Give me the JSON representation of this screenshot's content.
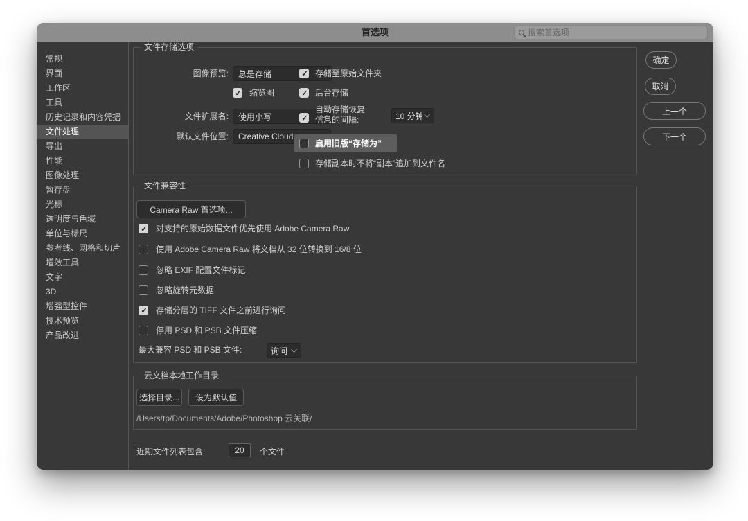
{
  "window": {
    "title": "首选项",
    "search": {
      "placeholder": "搜索首选项"
    }
  },
  "sidebar": {
    "items": [
      {
        "label": "常规",
        "selected": false
      },
      {
        "label": "界面",
        "selected": false
      },
      {
        "label": "工作区",
        "selected": false
      },
      {
        "label": "工具",
        "selected": false
      },
      {
        "label": "历史记录和内容凭据",
        "selected": false
      },
      {
        "label": "文件处理",
        "selected": true
      },
      {
        "label": "导出",
        "selected": false
      },
      {
        "label": "性能",
        "selected": false
      },
      {
        "label": "图像处理",
        "selected": false
      },
      {
        "label": "暂存盘",
        "selected": false
      },
      {
        "label": "光标",
        "selected": false
      },
      {
        "label": "透明度与色域",
        "selected": false
      },
      {
        "label": "单位与标尺",
        "selected": false
      },
      {
        "label": "参考线、网格和切片",
        "selected": false
      },
      {
        "label": "增效工具",
        "selected": false
      },
      {
        "label": "文字",
        "selected": false
      },
      {
        "label": "3D",
        "selected": false
      },
      {
        "label": "增强型控件",
        "selected": false
      },
      {
        "label": "技术预览",
        "selected": false
      },
      {
        "label": "产品改进",
        "selected": false
      }
    ]
  },
  "actions": {
    "ok": "确定",
    "cancel": "取消",
    "prev": "上一个",
    "next": "下一个"
  },
  "file_saving": {
    "title": "文件存储选项",
    "image_preview": {
      "label": "图像预览:",
      "value": "总是存储"
    },
    "thumbnail": {
      "label": "缩览图",
      "checked": true
    },
    "save_to_original": {
      "label": "存储至原始文件夹",
      "checked": true
    },
    "background_save": {
      "label": "后台存储",
      "checked": true
    },
    "file_extension": {
      "label": "文件扩展名:",
      "value": "使用小写"
    },
    "autosave": {
      "label_line1": "自动存储恢复",
      "label_line2": "信息的间隔:",
      "checked": true,
      "interval": "10 分钟"
    },
    "default_location": {
      "label": "默认文件位置:",
      "value": "Creative Cloud"
    },
    "legacy_save_as": {
      "label": "启用旧版“存储为”",
      "checked": false
    },
    "no_append_copy": {
      "label": "存储副本时不将“副本”追加到文件名",
      "checked": false
    }
  },
  "file_compatibility": {
    "title": "文件兼容性",
    "camera_raw_button": "Camera Raw 首选项...",
    "options": [
      {
        "label": "对支持的原始数据文件优先使用 Adobe Camera Raw",
        "checked": true
      },
      {
        "label": "使用 Adobe Camera Raw 将文档从 32 位转换到 16/8 位",
        "checked": false
      },
      {
        "label": "忽略 EXIF 配置文件标记",
        "checked": false
      },
      {
        "label": "忽略旋转元数据",
        "checked": false
      },
      {
        "label": "存储分层的 TIFF 文件之前进行询问",
        "checked": true
      },
      {
        "label": "停用 PSD 和 PSB 文件压缩",
        "checked": false
      }
    ],
    "max_compat": {
      "label": "最大兼容 PSD 和 PSB 文件:",
      "value": "询问"
    }
  },
  "cloud_documents": {
    "title": "云文档本地工作目录",
    "choose_dir_button": "选择目录...",
    "set_default_button": "设为默认值",
    "path": "/Users/tp/Documents/Adobe/Photoshop 云关联/"
  },
  "recent_files": {
    "label_prefix": "近期文件列表包含:",
    "count": "20",
    "label_suffix": "个文件"
  }
}
